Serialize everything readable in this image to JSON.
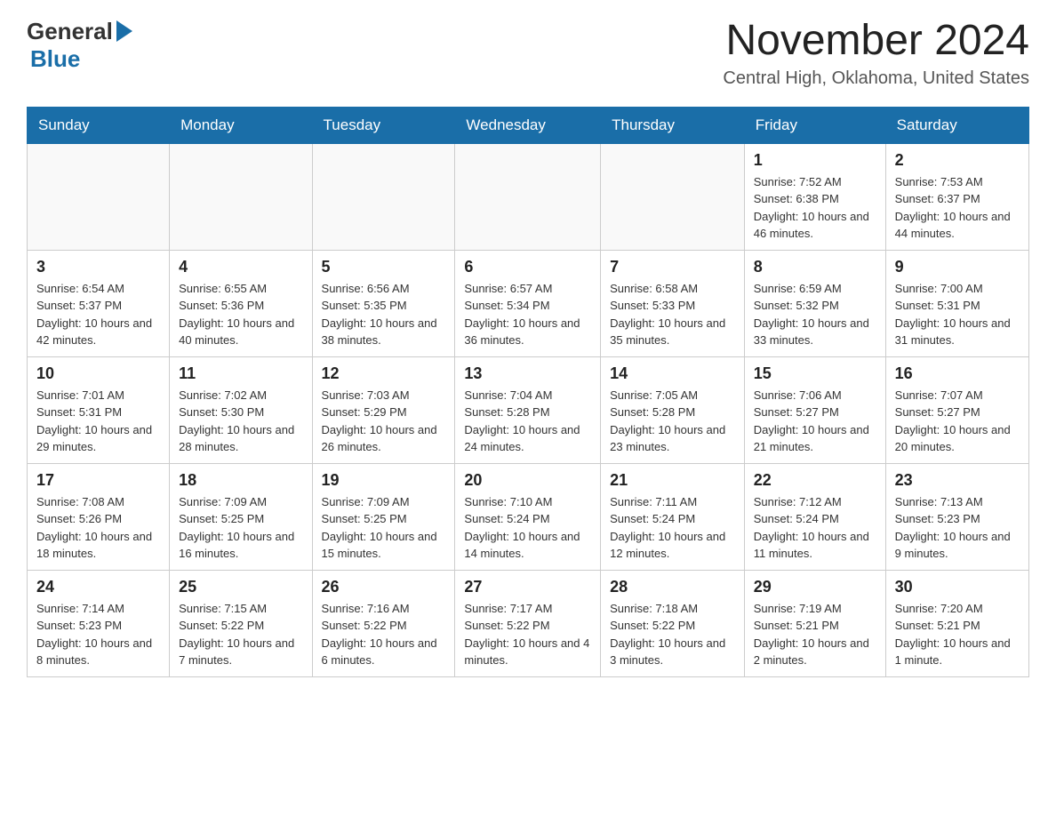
{
  "header": {
    "logo_general": "General",
    "logo_blue": "Blue",
    "month_title": "November 2024",
    "location": "Central High, Oklahoma, United States"
  },
  "days_of_week": [
    "Sunday",
    "Monday",
    "Tuesday",
    "Wednesday",
    "Thursday",
    "Friday",
    "Saturday"
  ],
  "weeks": [
    [
      {
        "num": "",
        "info": ""
      },
      {
        "num": "",
        "info": ""
      },
      {
        "num": "",
        "info": ""
      },
      {
        "num": "",
        "info": ""
      },
      {
        "num": "",
        "info": ""
      },
      {
        "num": "1",
        "info": "Sunrise: 7:52 AM\nSunset: 6:38 PM\nDaylight: 10 hours and 46 minutes."
      },
      {
        "num": "2",
        "info": "Sunrise: 7:53 AM\nSunset: 6:37 PM\nDaylight: 10 hours and 44 minutes."
      }
    ],
    [
      {
        "num": "3",
        "info": "Sunrise: 6:54 AM\nSunset: 5:37 PM\nDaylight: 10 hours and 42 minutes."
      },
      {
        "num": "4",
        "info": "Sunrise: 6:55 AM\nSunset: 5:36 PM\nDaylight: 10 hours and 40 minutes."
      },
      {
        "num": "5",
        "info": "Sunrise: 6:56 AM\nSunset: 5:35 PM\nDaylight: 10 hours and 38 minutes."
      },
      {
        "num": "6",
        "info": "Sunrise: 6:57 AM\nSunset: 5:34 PM\nDaylight: 10 hours and 36 minutes."
      },
      {
        "num": "7",
        "info": "Sunrise: 6:58 AM\nSunset: 5:33 PM\nDaylight: 10 hours and 35 minutes."
      },
      {
        "num": "8",
        "info": "Sunrise: 6:59 AM\nSunset: 5:32 PM\nDaylight: 10 hours and 33 minutes."
      },
      {
        "num": "9",
        "info": "Sunrise: 7:00 AM\nSunset: 5:31 PM\nDaylight: 10 hours and 31 minutes."
      }
    ],
    [
      {
        "num": "10",
        "info": "Sunrise: 7:01 AM\nSunset: 5:31 PM\nDaylight: 10 hours and 29 minutes."
      },
      {
        "num": "11",
        "info": "Sunrise: 7:02 AM\nSunset: 5:30 PM\nDaylight: 10 hours and 28 minutes."
      },
      {
        "num": "12",
        "info": "Sunrise: 7:03 AM\nSunset: 5:29 PM\nDaylight: 10 hours and 26 minutes."
      },
      {
        "num": "13",
        "info": "Sunrise: 7:04 AM\nSunset: 5:28 PM\nDaylight: 10 hours and 24 minutes."
      },
      {
        "num": "14",
        "info": "Sunrise: 7:05 AM\nSunset: 5:28 PM\nDaylight: 10 hours and 23 minutes."
      },
      {
        "num": "15",
        "info": "Sunrise: 7:06 AM\nSunset: 5:27 PM\nDaylight: 10 hours and 21 minutes."
      },
      {
        "num": "16",
        "info": "Sunrise: 7:07 AM\nSunset: 5:27 PM\nDaylight: 10 hours and 20 minutes."
      }
    ],
    [
      {
        "num": "17",
        "info": "Sunrise: 7:08 AM\nSunset: 5:26 PM\nDaylight: 10 hours and 18 minutes."
      },
      {
        "num": "18",
        "info": "Sunrise: 7:09 AM\nSunset: 5:25 PM\nDaylight: 10 hours and 16 minutes."
      },
      {
        "num": "19",
        "info": "Sunrise: 7:09 AM\nSunset: 5:25 PM\nDaylight: 10 hours and 15 minutes."
      },
      {
        "num": "20",
        "info": "Sunrise: 7:10 AM\nSunset: 5:24 PM\nDaylight: 10 hours and 14 minutes."
      },
      {
        "num": "21",
        "info": "Sunrise: 7:11 AM\nSunset: 5:24 PM\nDaylight: 10 hours and 12 minutes."
      },
      {
        "num": "22",
        "info": "Sunrise: 7:12 AM\nSunset: 5:24 PM\nDaylight: 10 hours and 11 minutes."
      },
      {
        "num": "23",
        "info": "Sunrise: 7:13 AM\nSunset: 5:23 PM\nDaylight: 10 hours and 9 minutes."
      }
    ],
    [
      {
        "num": "24",
        "info": "Sunrise: 7:14 AM\nSunset: 5:23 PM\nDaylight: 10 hours and 8 minutes."
      },
      {
        "num": "25",
        "info": "Sunrise: 7:15 AM\nSunset: 5:22 PM\nDaylight: 10 hours and 7 minutes."
      },
      {
        "num": "26",
        "info": "Sunrise: 7:16 AM\nSunset: 5:22 PM\nDaylight: 10 hours and 6 minutes."
      },
      {
        "num": "27",
        "info": "Sunrise: 7:17 AM\nSunset: 5:22 PM\nDaylight: 10 hours and 4 minutes."
      },
      {
        "num": "28",
        "info": "Sunrise: 7:18 AM\nSunset: 5:22 PM\nDaylight: 10 hours and 3 minutes."
      },
      {
        "num": "29",
        "info": "Sunrise: 7:19 AM\nSunset: 5:21 PM\nDaylight: 10 hours and 2 minutes."
      },
      {
        "num": "30",
        "info": "Sunrise: 7:20 AM\nSunset: 5:21 PM\nDaylight: 10 hours and 1 minute."
      }
    ]
  ]
}
